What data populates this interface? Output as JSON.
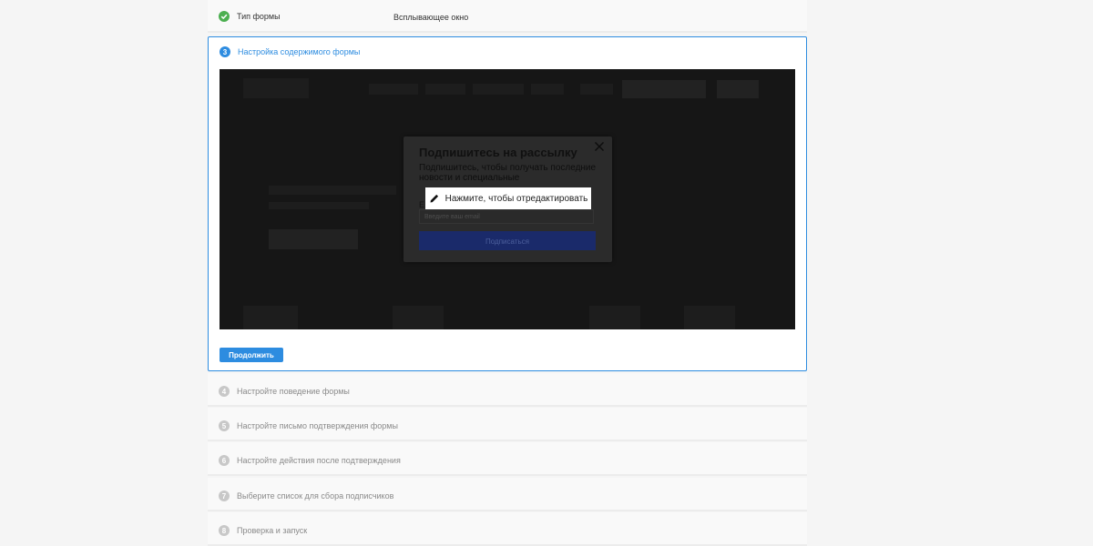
{
  "steps": {
    "form_type": {
      "title": "Тип формы",
      "value": "Всплывающее окно"
    },
    "content": {
      "number": "3",
      "title": "Настройка содержимого формы"
    },
    "behavior": {
      "number": "4",
      "title": "Настройте поведение формы"
    },
    "confirm_email": {
      "number": "5",
      "title": "Настройте письмо подтверждения формы"
    },
    "after_confirm": {
      "number": "6",
      "title": "Настройте действия после подтверждения"
    },
    "list": {
      "number": "7",
      "title": "Выберите список для сбора подписчиков"
    },
    "review": {
      "number": "8",
      "title": "Проверка и запуск"
    }
  },
  "preview": {
    "popup": {
      "title": "Подпишитесь на рассылку",
      "text": "Подпишитесь, чтобы получать последние новости и специальные",
      "email_label": "E",
      "email_placeholder": "Введите ваш email",
      "submit_label": "Подписаться"
    },
    "edit_tip": "Нажмите, чтобы отредактировать"
  },
  "continue_label": "Продолжить",
  "colors": {
    "accent": "#2d8ce0",
    "success": "#4caf50",
    "inactive": "#c8c8c8"
  },
  "icons": {
    "done": "check-circle-icon",
    "close": "close-icon",
    "edit": "pencil-icon"
  }
}
